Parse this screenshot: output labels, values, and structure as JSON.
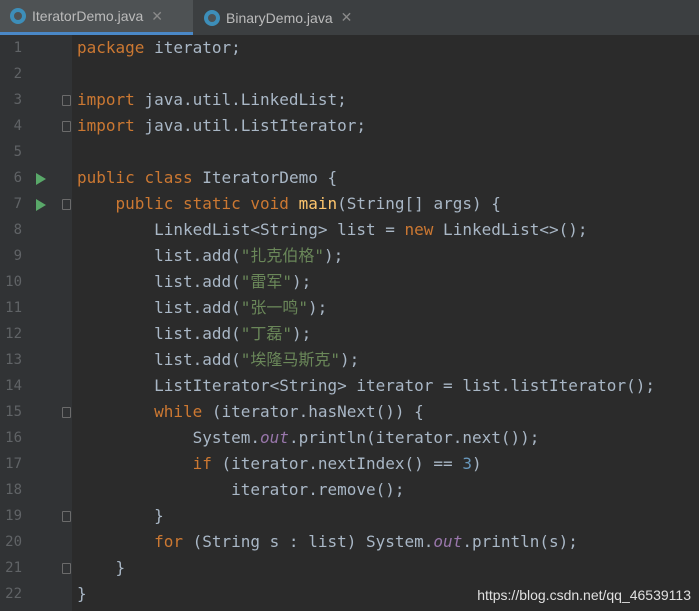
{
  "tabs": [
    {
      "label": "IteratorDemo.java",
      "active": true
    },
    {
      "label": "BinaryDemo.java",
      "active": false
    }
  ],
  "code": {
    "l1": {
      "n": "1",
      "a": "package",
      "b": " iterator;"
    },
    "l2": {
      "n": "2"
    },
    "l3": {
      "n": "3",
      "a": "import",
      "b": " java.util.LinkedList;"
    },
    "l4": {
      "n": "4",
      "a": "import",
      "b": " java.util.ListIterator;"
    },
    "l5": {
      "n": "5"
    },
    "l6": {
      "n": "6",
      "a": "public",
      "b": " ",
      "c": "class",
      "d": " IteratorDemo {"
    },
    "l7": {
      "n": "7",
      "a": "    ",
      "b": "public",
      "c": " ",
      "d": "static",
      "e": " ",
      "f": "void",
      "g": " ",
      "h": "main",
      "i": "(String[] args) {"
    },
    "l8": {
      "n": "8",
      "a": "        LinkedList<String> list = ",
      "b": "new",
      "c": " LinkedList<>();"
    },
    "l9": {
      "n": "9",
      "a": "        list.add(",
      "b": "\"扎克伯格\"",
      "c": ");"
    },
    "l10": {
      "n": "10",
      "a": "        list.add(",
      "b": "\"雷军\"",
      "c": ");"
    },
    "l11": {
      "n": "11",
      "a": "        list.add(",
      "b": "\"张一鸣\"",
      "c": ");"
    },
    "l12": {
      "n": "12",
      "a": "        list.add(",
      "b": "\"丁磊\"",
      "c": ");"
    },
    "l13": {
      "n": "13",
      "a": "        list.add(",
      "b": "\"埃隆马斯克\"",
      "c": ");"
    },
    "l14": {
      "n": "14",
      "a": "        ListIterator<String> iterator = list.listIterator();"
    },
    "l15": {
      "n": "15",
      "a": "        ",
      "b": "while",
      "c": " (iterator.hasNext()) {"
    },
    "l16": {
      "n": "16",
      "a": "            System.",
      "b": "out",
      "c": ".println(iterator.next());"
    },
    "l17": {
      "n": "17",
      "a": "            ",
      "b": "if",
      "c": " (iterator.nextIndex() == ",
      "d": "3",
      "e": ")"
    },
    "l18": {
      "n": "18",
      "a": "                iterator.remove();"
    },
    "l19": {
      "n": "19",
      "a": "        }"
    },
    "l20": {
      "n": "20",
      "a": "        ",
      "b": "for",
      "c": " (String s : list) System.",
      "d": "out",
      "e": ".println(s);"
    },
    "l21": {
      "n": "21",
      "a": "    }"
    },
    "l22": {
      "n": "22",
      "a": "}"
    }
  },
  "watermark": "https://blog.csdn.net/qq_46539113",
  "colors": {
    "keyword": "#cc7832",
    "string": "#6a8759",
    "method": "#ffc66d",
    "static_field": "#9876aa",
    "number": "#6897bb",
    "text": "#a9b7c6",
    "background": "#2b2b2b"
  }
}
